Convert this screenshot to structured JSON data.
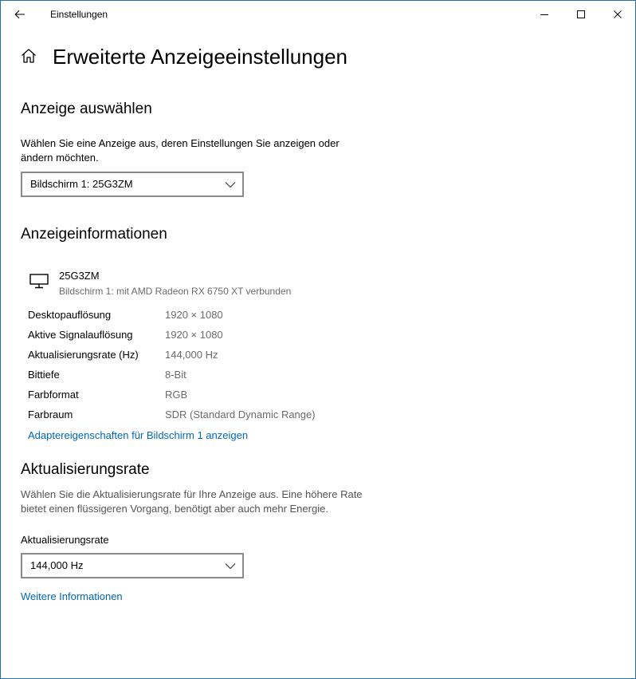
{
  "window": {
    "app_title": "Einstellungen"
  },
  "page": {
    "title": "Erweiterte Anzeigeeinstellungen"
  },
  "select_display": {
    "heading": "Anzeige auswählen",
    "description": "Wählen Sie eine Anzeige aus, deren Einstellungen Sie anzeigen oder ändern möchten.",
    "dropdown_value": "Bildschirm 1: 25G3ZM"
  },
  "display_info": {
    "heading": "Anzeigeinformationen",
    "monitor_name": "25G3ZM",
    "monitor_subtitle": "Bildschirm 1: mit AMD Radeon RX 6750 XT verbunden",
    "rows": [
      {
        "label": "Desktopauflösung",
        "value": "1920 × 1080"
      },
      {
        "label": "Aktive Signalauflösung",
        "value": "1920 × 1080"
      },
      {
        "label": "Aktualisierungsrate (Hz)",
        "value": "144,000 Hz"
      },
      {
        "label": "Bittiefe",
        "value": "8-Bit"
      },
      {
        "label": "Farbformat",
        "value": "RGB"
      },
      {
        "label": "Farbraum",
        "value": "SDR (Standard Dynamic Range)"
      }
    ],
    "adapter_link": "Adaptereigenschaften für Bildschirm 1 anzeigen"
  },
  "refresh_rate": {
    "heading": "Aktualisierungsrate",
    "description": "Wählen Sie die Aktualisierungsrate für Ihre Anzeige aus. Eine höhere Rate bietet einen flüssigeren Vorgang, benötigt aber auch mehr Energie.",
    "field_label": "Aktualisierungsrate",
    "dropdown_value": "144,000 Hz",
    "more_info_link": "Weitere Informationen"
  },
  "icons": {
    "back": "back-arrow-icon",
    "minimize": "minimize-icon",
    "maximize": "maximize-icon",
    "close": "close-icon",
    "home": "home-icon",
    "monitor": "monitor-icon",
    "chevron": "chevron-down-icon"
  },
  "colors": {
    "accent_link": "#0067b8",
    "window_border": "#1f6fb2",
    "muted_text": "#6b6b6b",
    "dropdown_border": "#8a8a8a"
  }
}
